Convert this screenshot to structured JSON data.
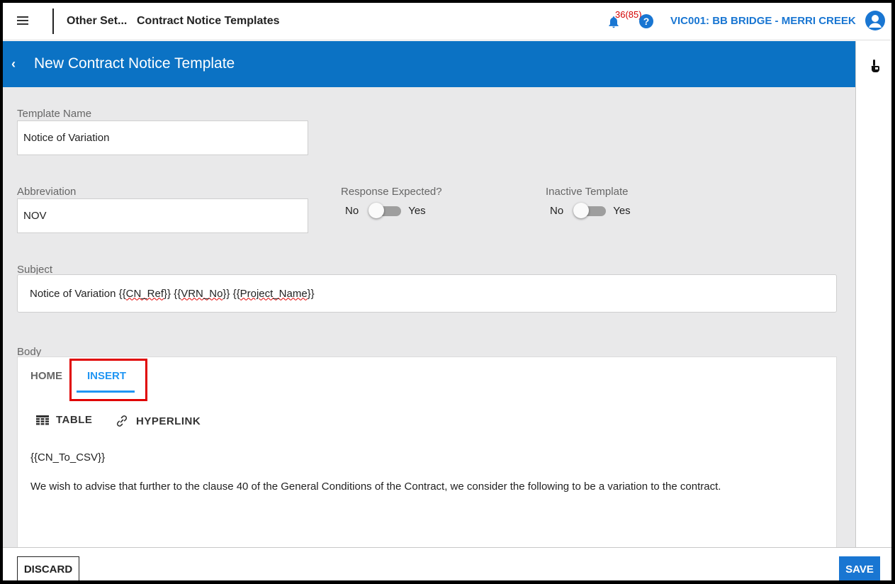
{
  "topbar": {
    "breadcrumb_parent": "Other Set...",
    "breadcrumb_current": "Contract Notice Templates",
    "notification_count": "36(85)",
    "help_glyph": "?",
    "project_name": "VIC001: BB BRIDGE - MERRI CREEK"
  },
  "header": {
    "back_glyph": "‹",
    "title": "New Contract Notice Template"
  },
  "form": {
    "template_name_label": "Template Name",
    "template_name_value": "Notice of Variation",
    "abbreviation_label": "Abbreviation",
    "abbreviation_value": "NOV",
    "response_expected": {
      "label": "Response Expected?",
      "off_label": "No",
      "on_label": "Yes",
      "checked": false
    },
    "inactive_template": {
      "label": "Inactive Template",
      "off_label": "No",
      "on_label": "Yes",
      "checked": false
    },
    "subject_label": "Subject",
    "subject_parts": {
      "prefix": "Notice of Variation {{",
      "cn_ref": "CN_Ref",
      "mid1": "}} {{",
      "vrn_no": "VRN_No",
      "mid2": "}} {{",
      "project_name": "Project_Name",
      "suffix": "}}"
    },
    "body_label": "Body"
  },
  "editor": {
    "tabs": {
      "home": "HOME",
      "insert": "INSERT"
    },
    "active_tab": "INSERT",
    "tools": {
      "table": "TABLE",
      "hyperlink": "HYPERLINK"
    },
    "content": {
      "line1": "{{CN_To_CSV}}",
      "line2": "We wish to advise that further to the clause 40 of the General Conditions of the Contract, we consider the following to be a variation to the contract."
    }
  },
  "footer": {
    "discard_label": "DISCARD",
    "save_label": "SAVE"
  },
  "icons": {
    "menu": "hamburger-menu-icon",
    "bell": "bell-icon",
    "help": "help-icon",
    "avatar": "user-avatar-icon",
    "side": "hand-pointer-icon",
    "table": "table-grid-icon",
    "link": "link-icon"
  },
  "colors": {
    "accent": "#0b72c4",
    "primary_button": "#1976d2",
    "active_tab": "#2196f3",
    "highlight": "#e00000",
    "notification": "#d40000",
    "form_background": "#e9e9ea"
  }
}
